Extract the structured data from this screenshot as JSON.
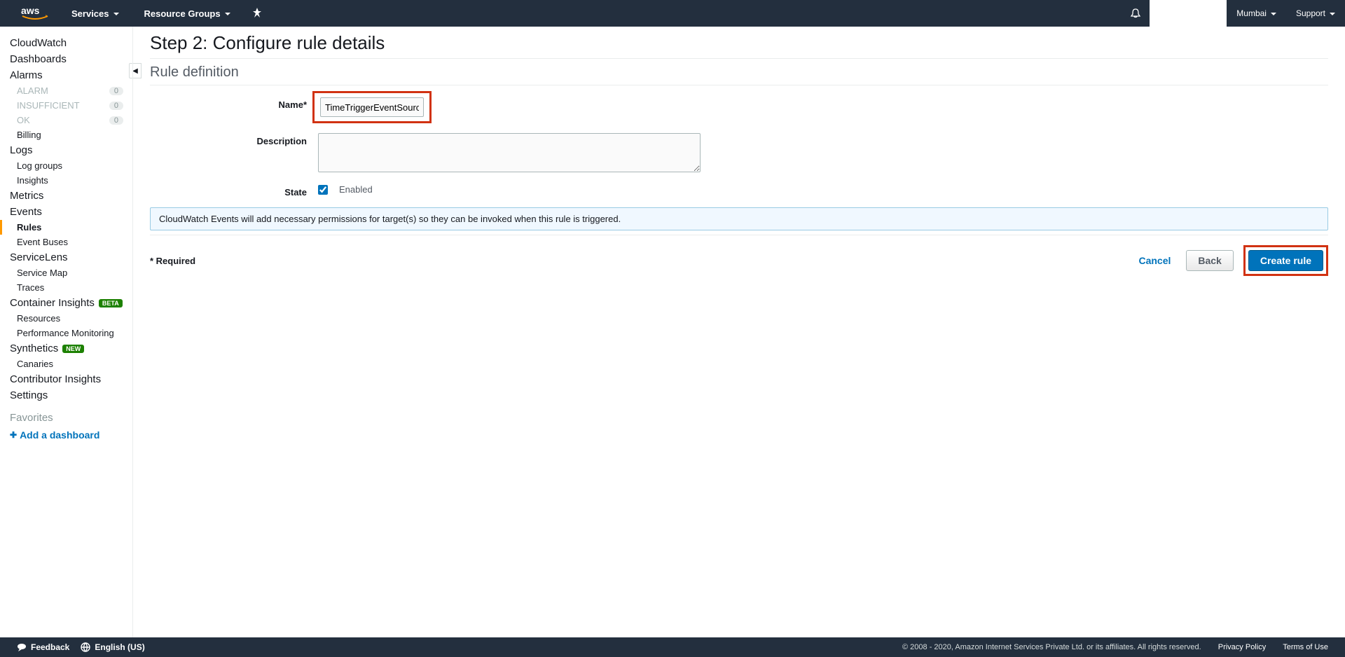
{
  "header": {
    "services": "Services",
    "resource_groups": "Resource Groups",
    "region": "Mumbai",
    "support": "Support"
  },
  "sidebar": {
    "cloudwatch": "CloudWatch",
    "dashboards": "Dashboards",
    "alarms": "Alarms",
    "alarm": {
      "label": "ALARM",
      "count": "0"
    },
    "insufficient": {
      "label": "INSUFFICIENT",
      "count": "0"
    },
    "ok": {
      "label": "OK",
      "count": "0"
    },
    "billing": "Billing",
    "logs": "Logs",
    "log_groups": "Log groups",
    "insights": "Insights",
    "metrics": "Metrics",
    "events": "Events",
    "rules": "Rules",
    "event_buses": "Event Buses",
    "servicelens": "ServiceLens",
    "service_map": "Service Map",
    "traces": "Traces",
    "container_insights": "Container Insights",
    "container_badge": "BETA",
    "resources": "Resources",
    "perf_monitoring": "Performance Monitoring",
    "synthetics": "Synthetics",
    "synthetics_badge": "NEW",
    "canaries": "Canaries",
    "contributor_insights": "Contributor Insights",
    "settings": "Settings",
    "favorites": "Favorites",
    "add_dashboard": "Add a dashboard"
  },
  "content": {
    "step_title": "Step 2: Configure rule details",
    "section_title": "Rule definition",
    "name_label": "Name*",
    "name_value": "TimeTriggerEventSource",
    "description_label": "Description",
    "description_value": "",
    "state_label": "State",
    "enabled_label": "Enabled",
    "info_message": "CloudWatch Events will add necessary permissions for target(s) so they can be invoked when this rule is triggered.",
    "required": "Required",
    "cancel": "Cancel",
    "back": "Back",
    "create_rule": "Create rule"
  },
  "footer": {
    "feedback": "Feedback",
    "language": "English (US)",
    "copyright": "© 2008 - 2020, Amazon Internet Services Private Ltd. or its affiliates. All rights reserved.",
    "privacy": "Privacy Policy",
    "terms": "Terms of Use"
  }
}
